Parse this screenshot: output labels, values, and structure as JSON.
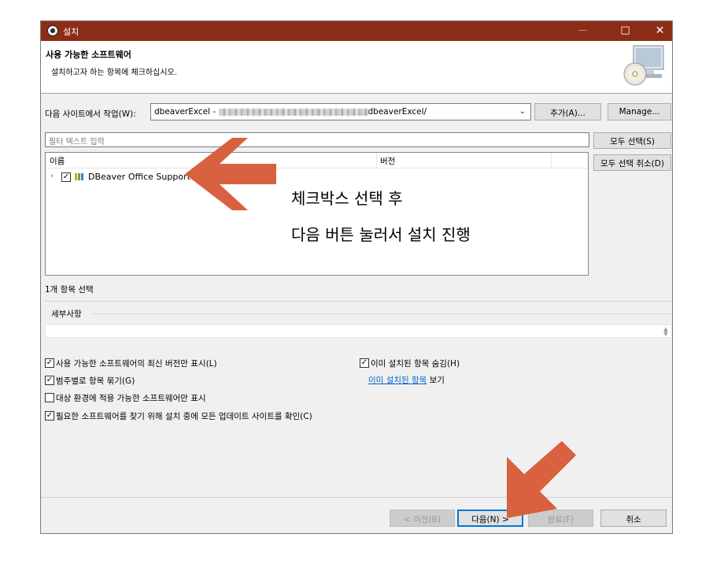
{
  "window": {
    "title": "설치",
    "controls": {
      "minimize": "—",
      "maximize": "□",
      "close": "✕"
    }
  },
  "header": {
    "title": "사용 가능한 소프트웨어",
    "subtitle": "설치하고자 하는 항목에 체크하십시오.",
    "icon": "cd-monitor-icon"
  },
  "site": {
    "label": "다음 사이트에서 작업(W):",
    "value_prefix": "dbeaverExcel - ",
    "value_suffix": "dbeaverExcel/",
    "add_button": "추가(A)...",
    "manage_button": "Manage..."
  },
  "filter": {
    "placeholder": "필터 텍스트 입력"
  },
  "side_buttons": {
    "select_all": "모두 선택(S)",
    "deselect_all": "모두 선택 취소(D)"
  },
  "tree": {
    "columns": [
      "이름",
      "버전"
    ],
    "items": [
      {
        "label": "DBeaver Office Support",
        "checked": true,
        "expanded": false
      }
    ]
  },
  "selection_count": "1개 항목 선택",
  "details": {
    "label": "세부사항"
  },
  "options": {
    "latest_only": {
      "label": "사용 가능한 소프트웨어의 최신 버전만 표시(L)",
      "checked": true
    },
    "group_by_category": {
      "label": "범주별로 항목 묶기(G)",
      "checked": true
    },
    "target_env_only": {
      "label": "대상 환경에 적용 가능한 소프트웨어만 표시",
      "checked": false
    },
    "contact_all_sites": {
      "label": "필요한 소프트웨어를 찾기 위해 설치 중에 모든 업데이트 사이트를 확인(C)",
      "checked": true
    },
    "hide_installed": {
      "label": "이미 설치된 항목 숨김(H)",
      "checked": true
    },
    "installed_link": "이미 설치된 항목",
    "installed_suffix": "보기"
  },
  "footer": {
    "back": "< 이전(B)",
    "next": "다음(N) >",
    "finish": "완료(F)",
    "cancel": "취소"
  },
  "annotation": {
    "line1": "체크박스 선택 후",
    "line2": "다음 버튼 눌러서 설치 진행",
    "arrow_color": "#d9613f"
  }
}
